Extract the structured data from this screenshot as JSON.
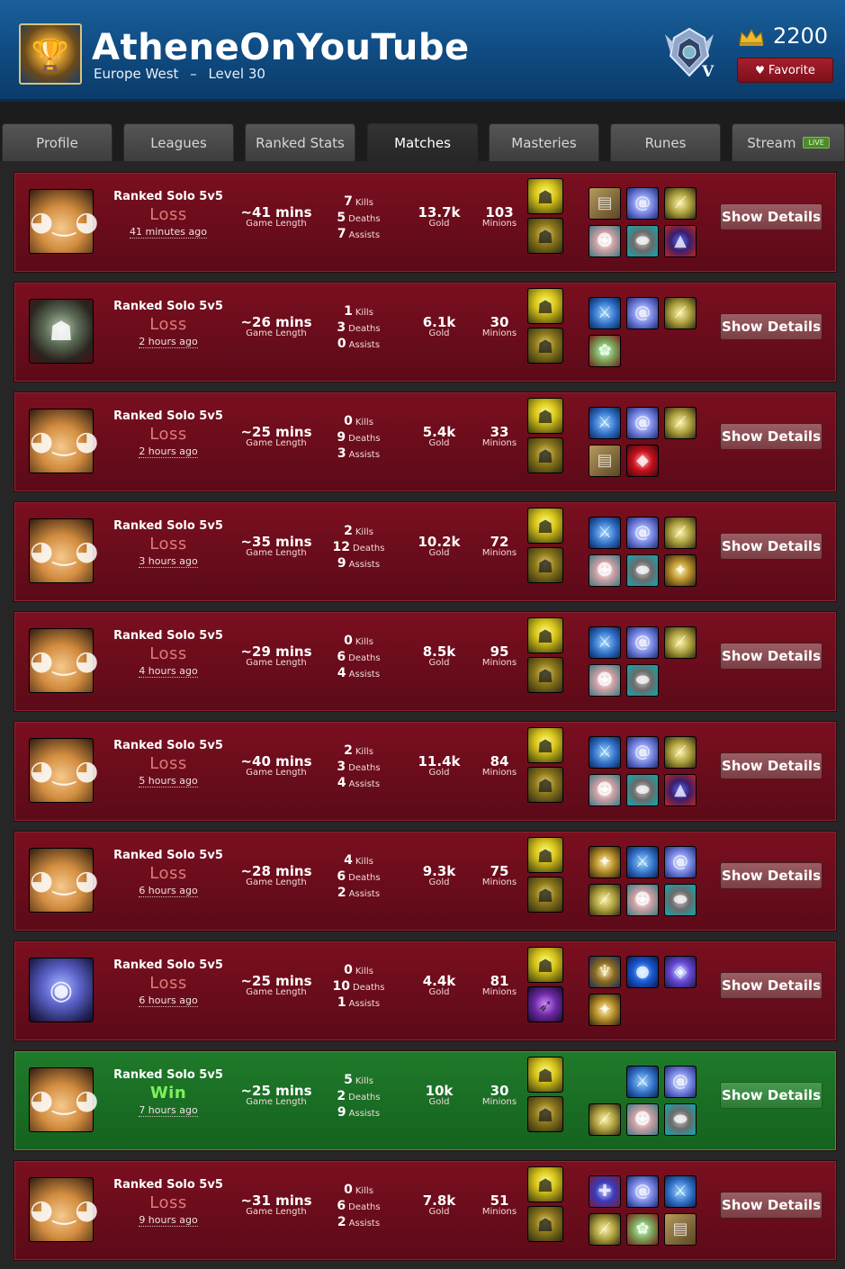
{
  "header": {
    "name": "AtheneOnYouTube",
    "region": "Europe West",
    "separator": "–",
    "level": "Level 30",
    "rank_numeral": "V",
    "lp": "2200",
    "favorite_label": "Favorite"
  },
  "tabs": [
    {
      "label": "Profile"
    },
    {
      "label": "Leagues"
    },
    {
      "label": "Ranked Stats"
    },
    {
      "label": "Matches",
      "active": true
    },
    {
      "label": "Masteries"
    },
    {
      "label": "Runes"
    },
    {
      "label": "Stream",
      "badge": "LIVE"
    }
  ],
  "labels": {
    "game_length": "Game Length",
    "kills": "Kills",
    "deaths": "Deaths",
    "assists": "Assists",
    "gold": "Gold",
    "minions": "Minions",
    "show_details": "Show Details"
  },
  "matches": [
    {
      "champion": "teemo",
      "queue": "Ranked Solo 5v5",
      "result": "Loss",
      "ago": "41 minutes ago",
      "length": "~41 mins",
      "kills": "7",
      "deaths": "5",
      "assists": "7",
      "gold": "13.7k",
      "minions": "103",
      "spells": [
        "flash-icon",
        "ignite-icon"
      ],
      "items": [
        "book",
        "spiral",
        "sword",
        "mask",
        "boots",
        "hat"
      ]
    },
    {
      "champion": "shaco",
      "queue": "Ranked Solo 5v5",
      "result": "Loss",
      "ago": "2 hours ago",
      "length": "~26 mins",
      "kills": "1",
      "deaths": "3",
      "assists": "0",
      "gold": "6.1k",
      "minions": "30",
      "spells": [
        "flash-icon",
        "ignite-icon"
      ],
      "items": [
        "blue",
        "spiral",
        "sword",
        "tentacle"
      ]
    },
    {
      "champion": "teemo",
      "queue": "Ranked Solo 5v5",
      "result": "Loss",
      "ago": "2 hours ago",
      "length": "~25 mins",
      "kills": "0",
      "deaths": "9",
      "assists": "3",
      "gold": "5.4k",
      "minions": "33",
      "spells": [
        "flash-icon",
        "ignite-icon"
      ],
      "items": [
        "blue",
        "spiral",
        "sword",
        "book",
        "ruby"
      ]
    },
    {
      "champion": "teemo",
      "queue": "Ranked Solo 5v5",
      "result": "Loss",
      "ago": "3 hours ago",
      "length": "~35 mins",
      "kills": "2",
      "deaths": "12",
      "assists": "9",
      "gold": "10.2k",
      "minions": "72",
      "spells": [
        "flash-icon",
        "ignite-icon"
      ],
      "items": [
        "blue",
        "spiral",
        "sword",
        "mask",
        "boots",
        "scepter"
      ]
    },
    {
      "champion": "teemo",
      "queue": "Ranked Solo 5v5",
      "result": "Loss",
      "ago": "4 hours ago",
      "length": "~29 mins",
      "kills": "0",
      "deaths": "6",
      "assists": "4",
      "gold": "8.5k",
      "minions": "95",
      "spells": [
        "flash-icon",
        "ignite-icon"
      ],
      "items": [
        "blue",
        "spiral",
        "sword",
        "mask",
        "boots"
      ]
    },
    {
      "champion": "teemo",
      "queue": "Ranked Solo 5v5",
      "result": "Loss",
      "ago": "5 hours ago",
      "length": "~40 mins",
      "kills": "2",
      "deaths": "3",
      "assists": "4",
      "gold": "11.4k",
      "minions": "84",
      "spells": [
        "flash-icon",
        "ignite-icon"
      ],
      "items": [
        "blue",
        "spiral",
        "sword",
        "mask",
        "boots",
        "hat"
      ]
    },
    {
      "champion": "teemo",
      "queue": "Ranked Solo 5v5",
      "result": "Loss",
      "ago": "6 hours ago",
      "length": "~28 mins",
      "kills": "4",
      "deaths": "6",
      "assists": "2",
      "gold": "9.3k",
      "minions": "75",
      "spells": [
        "flash-icon",
        "ignite-icon"
      ],
      "items": [
        "scepter",
        "blue",
        "spiral",
        "sword",
        "mask",
        "boots"
      ]
    },
    {
      "champion": "kassadin",
      "queue": "Ranked Solo 5v5",
      "result": "Loss",
      "ago": "6 hours ago",
      "length": "~25 mins",
      "kills": "0",
      "deaths": "10",
      "assists": "1",
      "gold": "4.4k",
      "minions": "81",
      "spells": [
        "flash-icon",
        "ghost-icon"
      ],
      "items": [
        "chalice",
        "tear",
        "catalyst",
        "scepter"
      ]
    },
    {
      "champion": "teemo",
      "queue": "Ranked Solo 5v5",
      "result": "Win",
      "ago": "7 hours ago",
      "length": "~25 mins",
      "kills": "5",
      "deaths": "2",
      "assists": "9",
      "gold": "10k",
      "minions": "30",
      "spells": [
        "flash-icon",
        "ignite-icon"
      ],
      "items": [
        "",
        "blue",
        "spiral",
        "sword",
        "mask",
        "boots"
      ]
    },
    {
      "champion": "teemo",
      "queue": "Ranked Solo 5v5",
      "result": "Loss",
      "ago": "9 hours ago",
      "length": "~31 mins",
      "kills": "0",
      "deaths": "6",
      "assists": "2",
      "gold": "7.8k",
      "minions": "51",
      "spells": [
        "flash-icon",
        "ignite-icon"
      ],
      "items": [
        "guard",
        "spiral",
        "blue",
        "sword",
        "tentacle",
        "book"
      ]
    }
  ]
}
